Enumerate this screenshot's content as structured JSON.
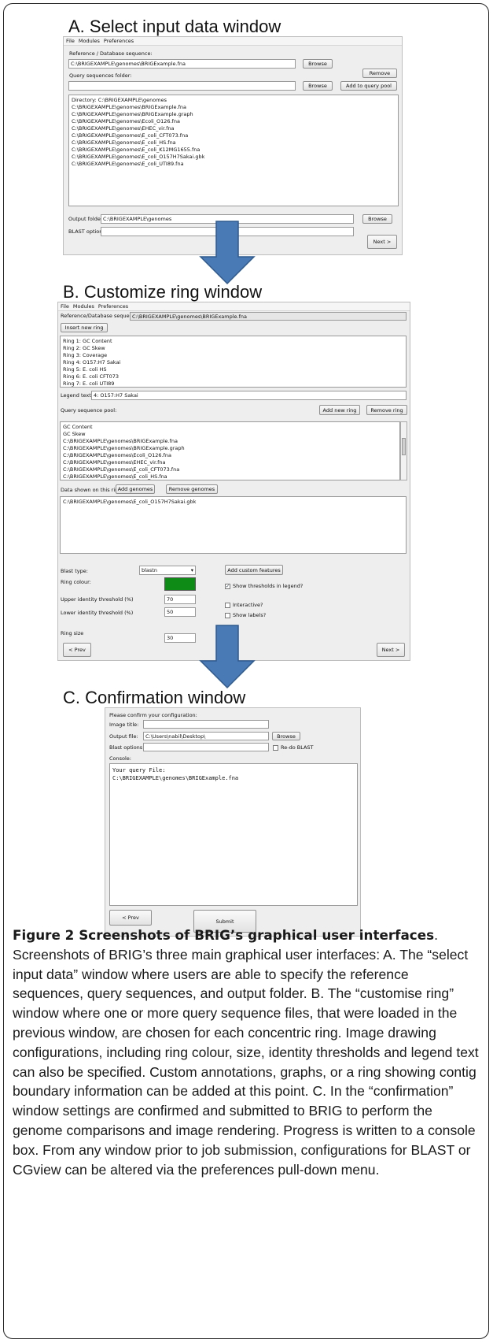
{
  "titles": {
    "a": "A. Select input data window",
    "b": "B. Customize ring window",
    "c": "C. Confirmation window"
  },
  "menu": {
    "file": "File",
    "modules": "Modules",
    "preferences": "Preferences"
  },
  "win_a": {
    "ref_label": "Reference / Database sequence:",
    "ref_value": "C:\\BRIGEXAMPLE\\genomes\\BRIGExample.fna",
    "browse": "Browse",
    "remove": "Remove",
    "query_label": "Query sequences folder:",
    "add_query": "Add to query pool",
    "files": [
      "Directory: C:\\BRIGEXAMPLE\\genomes",
      "C:\\BRIGEXAMPLE\\genomes\\BRIGExample.fna",
      "C:\\BRIGEXAMPLE\\genomes\\BRIGExample.graph",
      "C:\\BRIGEXAMPLE\\genomes\\Ecoli_O126.fna",
      "C:\\BRIGEXAMPLE\\genomes\\EHEC_vir.fna",
      "C:\\BRIGEXAMPLE\\genomes\\E_coli_CFT073.fna",
      "C:\\BRIGEXAMPLE\\genomes\\E_coli_HS.fna",
      "C:\\BRIGEXAMPLE\\genomes\\E_coli_K12MG1655.fna",
      "C:\\BRIGEXAMPLE\\genomes\\E_coli_O157H7Sakai.gbk",
      "C:\\BRIGEXAMPLE\\genomes\\E_coli_UTI89.fna"
    ],
    "output_label": "Output folder",
    "output_value": "C:\\BRIGEXAMPLE\\genomes",
    "blast_label": "BLAST options",
    "next": "Next >"
  },
  "win_b": {
    "ref_label": "Reference/Database sequence:",
    "ref_value": "C:\\BRIGEXAMPLE\\genomes\\BRIGExample.fna",
    "insert_ring": "Insert new ring",
    "rings": [
      "Ring 1: GC Content",
      "Ring 2: GC Skew",
      "Ring 3: Coverage",
      "Ring 4: O157:H7 Sakai",
      "Ring 5: E. coli HS",
      "Ring 6: E. coli CFT073",
      "Ring 7: E. coli UTI89"
    ],
    "legend_label": "Legend text:",
    "legend_value": "4: O157:H7 Sakai",
    "pool_label": "Query sequence pool:",
    "add_ring": "Add new ring",
    "remove_ring": "Remove ring",
    "pool": [
      "GC Content",
      "GC Skew",
      "C:\\BRIGEXAMPLE\\genomes\\BRIGExample.fna",
      "C:\\BRIGEXAMPLE\\genomes\\BRIGExample.graph",
      "C:\\BRIGEXAMPLE\\genomes\\Ecoli_O126.fna",
      "C:\\BRIGEXAMPLE\\genomes\\EHEC_vir.fna",
      "C:\\BRIGEXAMPLE\\genomes\\E_coli_CFT073.fna",
      "C:\\BRIGEXAMPLE\\genomes\\E_coli_HS.fna"
    ],
    "shown_label": "Data shown on this ring:",
    "add_genomes": "Add genomes",
    "remove_genomes": "Remove genomes",
    "shown": [
      "C:\\BRIGEXAMPLE\\genomes\\E_coli_O157H7Sakai.gbk"
    ],
    "blast_type_label": "Blast type:",
    "blast_type_value": "blastn",
    "add_custom": "Add custom features",
    "ring_colour_label": "Ring colour:",
    "ring_colour": "#0e8a16",
    "show_thresholds": "Show thresholds in legend?",
    "upper_label": "Upper identity threshold (%)",
    "upper_value": "70",
    "lower_label": "Lower identity threshold (%)",
    "lower_value": "50",
    "interactive": "Interactive?",
    "show_labels": "Show labels?",
    "ring_size_label": "Ring size",
    "ring_size_value": "30",
    "prev": "< Prev",
    "next": "Next >"
  },
  "win_c": {
    "confirm_label": "Please confirm your configuration:",
    "image_title_label": "Image title:",
    "output_label": "Output file:",
    "output_value": "C:\\Users\\nabil\\Desktop\\",
    "browse": "Browse",
    "blast_label": "Blast options:",
    "redo_blast": "Re-do BLAST",
    "console_label": "Console:",
    "console_lines": [
      "Your query File:",
      "C:\\BRIGEXAMPLE\\genomes\\BRIGExample.fna"
    ],
    "prev": "< Prev",
    "submit": "Submit"
  },
  "caption": {
    "label": "Figure 2 Screenshots of BRIG’s graphical user interfaces",
    "text": "Screenshots of BRIG’s three main graphical user interfaces: A. The “select input data” window where users are able to specify the reference sequences, query sequences, and output folder. B. The “customise ring” window where one or more query sequence files, that were loaded in the previous window, are chosen for each concentric ring. Image drawing configurations, including ring colour, size, identity thresholds and legend text can also be specified. Custom annotations, graphs, or a ring showing contig boundary information can be added at this point. C. In the “confirmation” window settings are confirmed and submitted to BRIG to perform the genome comparisons and image rendering. Progress is written to a console box. From any window prior to job submission, configurations for BLAST or CGview can be altered via the preferences pull-down menu."
  }
}
